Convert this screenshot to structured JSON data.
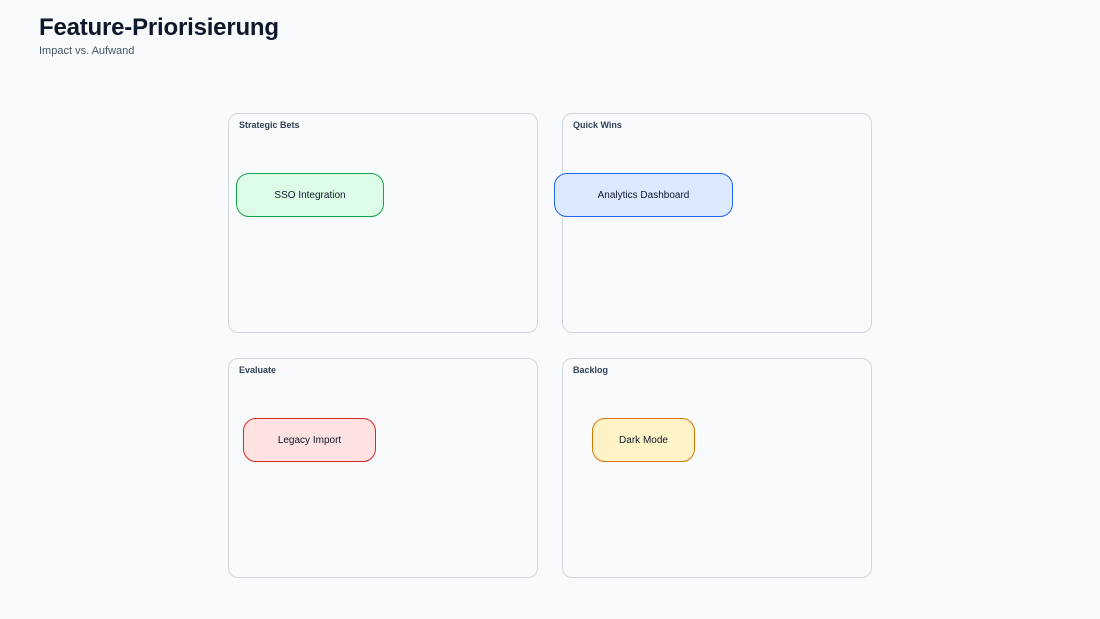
{
  "header": {
    "title": "Feature-Priorisierung",
    "subtitle": "Impact vs. Aufwand"
  },
  "quadrants": {
    "top_left": {
      "label": "Strategic Bets"
    },
    "top_right": {
      "label": "Quick Wins"
    },
    "bottom_left": {
      "label": "Evaluate"
    },
    "bottom_right": {
      "label": "Backlog"
    }
  },
  "features": [
    {
      "label": "SSO Integration",
      "quadrant": "Strategic Bets",
      "fill": "#dcfce7",
      "stroke": "#16a34a"
    },
    {
      "label": "Analytics Dashboard",
      "quadrant": "Quick Wins",
      "fill": "#dbeafe",
      "stroke": "#2563eb"
    },
    {
      "label": "Legacy Import",
      "quadrant": "Evaluate",
      "fill": "#fee2e2",
      "stroke": "#dc2626"
    },
    {
      "label": "Dark Mode",
      "quadrant": "Backlog",
      "fill": "#fef3c7",
      "stroke": "#d97706"
    }
  ],
  "colors": {
    "background": "#f8fafc",
    "quadrant_border": "#cfd8e3",
    "text": "#0f172a"
  }
}
